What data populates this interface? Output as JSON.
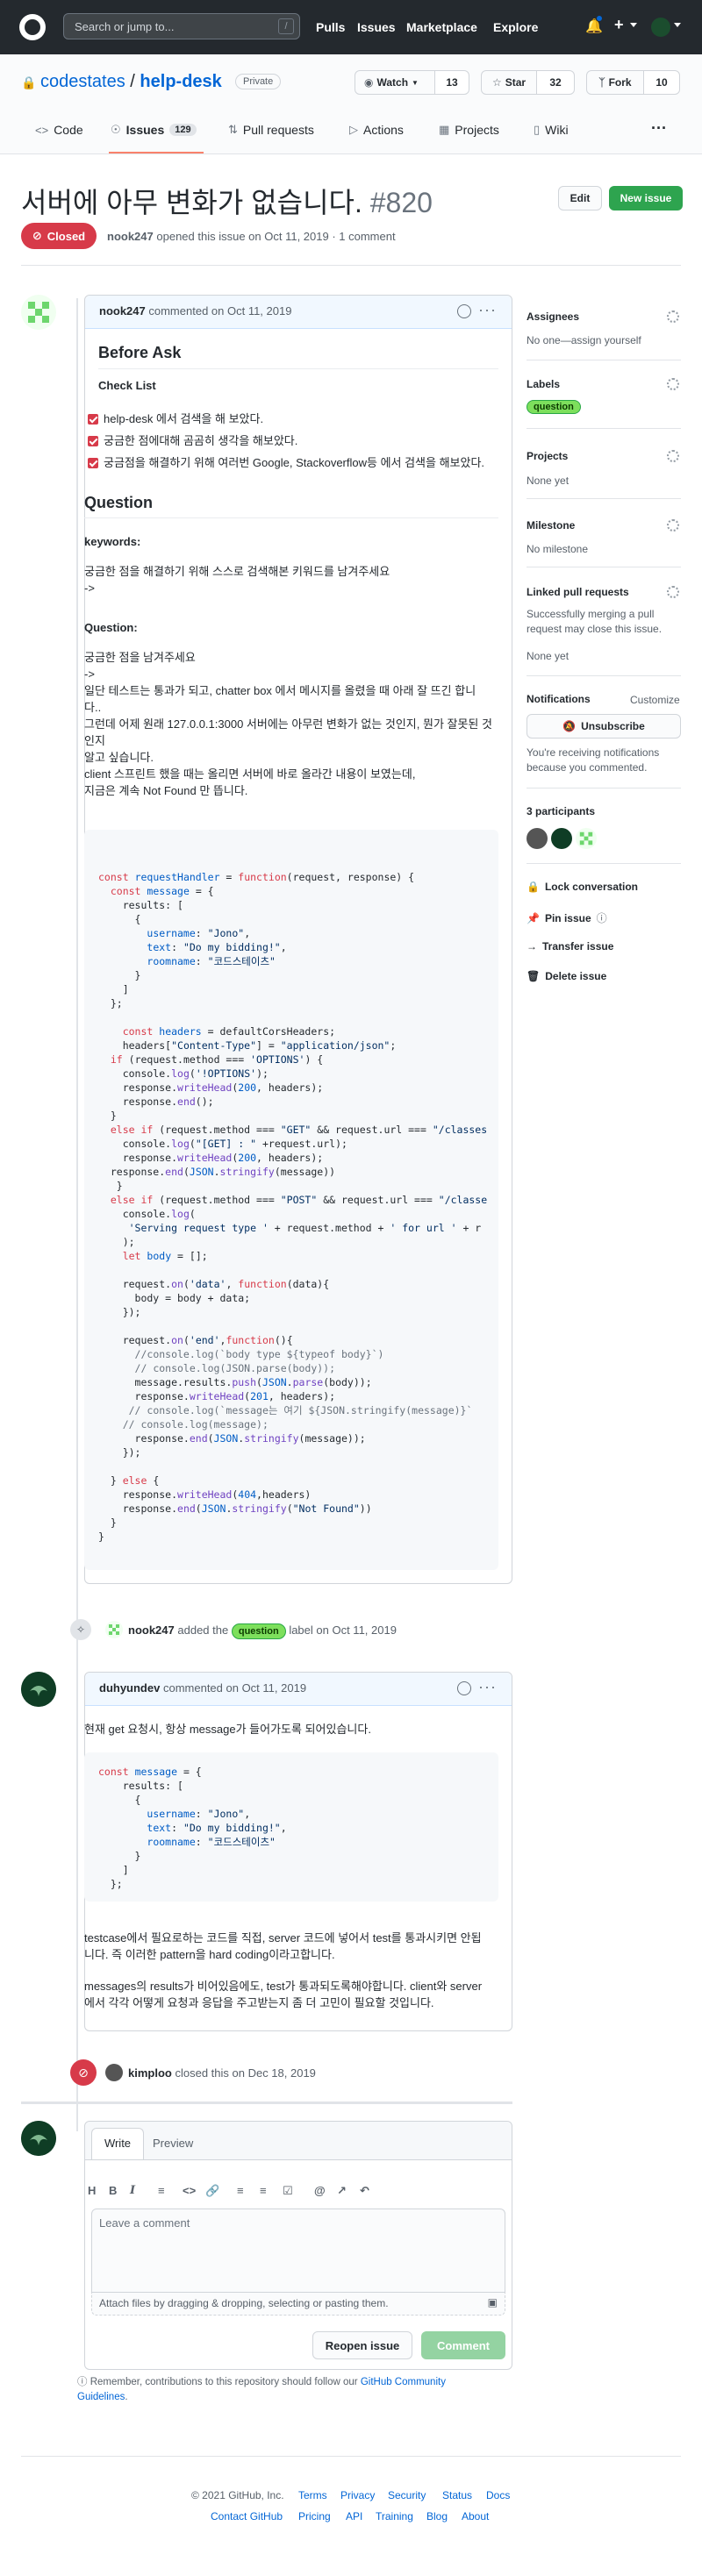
{
  "header": {
    "search_placeholder": "Search or jump to...",
    "search_key": "/",
    "nav": [
      "Pulls",
      "Issues",
      "Marketplace",
      "Explore"
    ]
  },
  "repo": {
    "owner": "codestates",
    "separator": "/",
    "name": "help-desk",
    "visibility": "Private",
    "watch_label": "Watch",
    "watch_count": "13",
    "star_label": "Star",
    "star_count": "32",
    "fork_label": "Fork",
    "fork_count": "10",
    "tabs": [
      {
        "label": "Code",
        "icon": "code-icon"
      },
      {
        "label": "Issues",
        "icon": "issue-opened-icon",
        "count": "129"
      },
      {
        "label": "Pull requests",
        "icon": "git-pull-request-icon"
      },
      {
        "label": "Actions",
        "icon": "play-icon"
      },
      {
        "label": "Projects",
        "icon": "project-icon"
      },
      {
        "label": "Wiki",
        "icon": "book-icon"
      }
    ]
  },
  "issue": {
    "title": "서버에 아무 변화가 없습니다.",
    "number": "#820",
    "edit_label": "Edit",
    "new_issue_label": "New issue",
    "state": "Closed",
    "author": "nook247",
    "meta": "opened this issue on Oct 11, 2019 · 1 comment"
  },
  "first_comment": {
    "author": "nook247",
    "date_text": "commented on Oct 11, 2019",
    "before_ask": "Before Ask",
    "check_list": "Check List",
    "checks": [
      "help-desk 에서 검색을 해 보았다.",
      "궁금한 점에대해 곰곰히 생각을 해보았다.",
      "궁금점을 해결하기 위해 여러번 Google, Stackoverflow등 에서 검색을 해보았다."
    ],
    "question_heading": "Question",
    "keywords_label": "keywords:",
    "keywords_text": "궁금한 점을 해결하기 위해 스스로 검색해본 키워드를 남겨주세요",
    "arrow1": "->",
    "question_label": "Question:",
    "q_line1": "궁금한 점을 남겨주세요",
    "q_line2": "->",
    "q_line3": "일단 테스트는 통과가 되고, chatter box 에서 메시지를 올렸을 때 아래 잘 뜨긴 합니",
    "q_line4": "다..",
    "q_line5": "그런데 어제 원래 127.0.0.1:3000 서버에는 아무런 변화가 없는 것인지, 뭔가 잘못된 것",
    "q_line6": "인지",
    "q_line7": "알고 싶습니다.",
    "q_line8": "client 스프린트 했을 때는 올리면 서버에 바로 올라간 내용이 보였는데,",
    "q_line9": "지금은 계속 Not Found 만 뜹니다."
  },
  "event_label": {
    "author": "nook247",
    "text_before": "added the",
    "label": "question",
    "text_after": "label on Oct 11, 2019"
  },
  "second_comment": {
    "author": "duhyundev",
    "date_text": "commented on Oct 11, 2019",
    "line1": "현재 get 요청시, 항상 message가 들어가도록 되어있습니다.",
    "p2_line1": "testcase에서 필요로하는 코드를 직접, server 코드에 넣어서 test를 통과시키면 안됩",
    "p2_line2": "니다. 즉 이러한 pattern을 hard coding이라고합니다.",
    "p3_line1": "messages의 results가 비어있음에도, test가 통과되도록해야합니다. client와 server",
    "p3_line2": "에서 각각 어떻게 요청과 응답을 주고받는지 좀 더 고민이 필요할 것입니다."
  },
  "event_closed": {
    "author": "kimploo",
    "text": "closed this on Dec 18, 2019"
  },
  "editor": {
    "tab_write": "Write",
    "tab_preview": "Preview",
    "placeholder": "Leave a comment",
    "attach_text": "Attach files by dragging & dropping, selecting or pasting them.",
    "reopen_label": "Reopen issue",
    "comment_label": "Comment",
    "remember_text": "Remember, contributions to this repository should follow our",
    "guidelines_link": "GitHub Community",
    "guidelines_link2": "Guidelines",
    "period": "."
  },
  "sidebar": {
    "assignees_title": "Assignees",
    "assignees_text": "No one—",
    "assign_yourself": "assign yourself",
    "labels_title": "Labels",
    "label": "question",
    "projects_title": "Projects",
    "projects_text": "None yet",
    "milestone_title": "Milestone",
    "milestone_text": "No milestone",
    "linked_title": "Linked pull requests",
    "linked_text1": "Successfully merging a pull",
    "linked_text2": "request may close this issue.",
    "linked_none": "None yet",
    "notifications_title": "Notifications",
    "customize": "Customize",
    "unsubscribe": "Unsubscribe",
    "notif_text1": "You're receiving notifications",
    "notif_text2": "because you commented.",
    "participants": "3 participants",
    "lock": "Lock conversation",
    "pin": "Pin issue",
    "transfer": "Transfer issue",
    "delete": "Delete issue"
  },
  "footer": {
    "copyright": "© 2021 GitHub, Inc.",
    "row1": [
      "Terms",
      "Privacy",
      "Security",
      "Status",
      "Docs"
    ],
    "row2": [
      "Contact GitHub",
      "Pricing",
      "API",
      "Training",
      "Blog",
      "About"
    ]
  },
  "colors": {
    "closed": "#d73a49",
    "green": "#2ea44f",
    "link": "#0366d6",
    "label_bg": "#7ddf5c"
  }
}
